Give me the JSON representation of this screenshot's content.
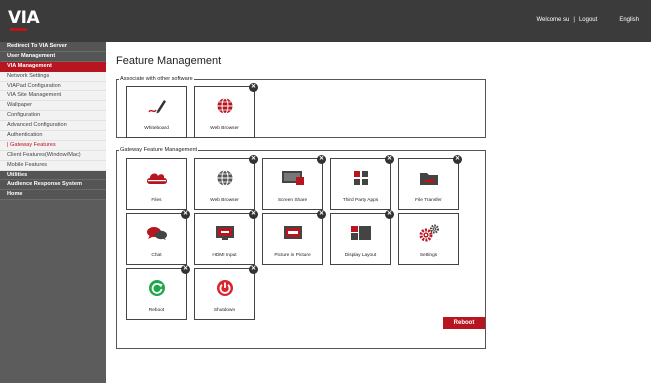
{
  "header": {
    "logo_text": "VIA",
    "welcome_text": "Welcome su",
    "separator": "|",
    "logout_label": "Logout",
    "language_label": "English"
  },
  "sidebar": {
    "items": [
      {
        "label": "Redirect To VIA Server",
        "kind": "main"
      },
      {
        "label": "User Management",
        "kind": "main"
      },
      {
        "label": "VIA Management",
        "kind": "active"
      },
      {
        "label": "Network Settings",
        "kind": "sub"
      },
      {
        "label": "VIAPad Configuration",
        "kind": "sub"
      },
      {
        "label": "VIA Site Management",
        "kind": "sub"
      },
      {
        "label": "Wallpaper",
        "kind": "sub"
      },
      {
        "label": "Configuration",
        "kind": "sub"
      },
      {
        "label": "Advanced Configuration",
        "kind": "sub"
      },
      {
        "label": "Authentication",
        "kind": "sub"
      },
      {
        "label": "| Gateway Features",
        "kind": "subactive"
      },
      {
        "label": "Client Features(Window/Mac)",
        "kind": "sub"
      },
      {
        "label": "Mobile Features",
        "kind": "sub"
      },
      {
        "label": "Utilities",
        "kind": "main"
      },
      {
        "label": "Audience Response System",
        "kind": "main"
      },
      {
        "label": "Home",
        "kind": "main"
      }
    ]
  },
  "main": {
    "title": "Feature Management",
    "associate": {
      "legend": "Associate with other software",
      "tiles": [
        {
          "label": "Whiteboard",
          "icon": "pen-icon",
          "closable": false
        },
        {
          "label": "Web Browser",
          "icon": "globe-icon",
          "closable": true
        }
      ]
    },
    "gateway": {
      "legend": "Gateway Feature Management",
      "tiles": [
        {
          "label": "Files",
          "icon": "cloud-icon",
          "closable": false
        },
        {
          "label": "Web Browser",
          "icon": "globe-icon",
          "closable": true
        },
        {
          "label": "Screen Share",
          "icon": "screen-share-icon",
          "closable": true
        },
        {
          "label": "Third Party Apps",
          "icon": "apps-grid-icon",
          "closable": true
        },
        {
          "label": "File Transfer",
          "icon": "folder-transfer-icon",
          "closable": true
        },
        {
          "label": "Chat",
          "icon": "chat-bubbles-icon",
          "closable": true
        },
        {
          "label": "HDMI Input",
          "icon": "hdmi-monitor-icon",
          "closable": true
        },
        {
          "label": "Picture in Picture",
          "icon": "pip-icon",
          "closable": true
        },
        {
          "label": "Display Layout",
          "icon": "layout-icon",
          "closable": true
        },
        {
          "label": "Settings",
          "icon": "gears-icon",
          "closable": false
        },
        {
          "label": "Reboot",
          "icon": "refresh-icon",
          "closable": true
        },
        {
          "label": "Shutdown",
          "icon": "power-icon",
          "closable": true
        }
      ]
    },
    "reboot_button_label": "Reboot",
    "close_glyph": "✕"
  },
  "colors": {
    "brand_red": "#b7151f",
    "topbar": "#3b3b3b",
    "sidebar": "#5c5c5c"
  }
}
